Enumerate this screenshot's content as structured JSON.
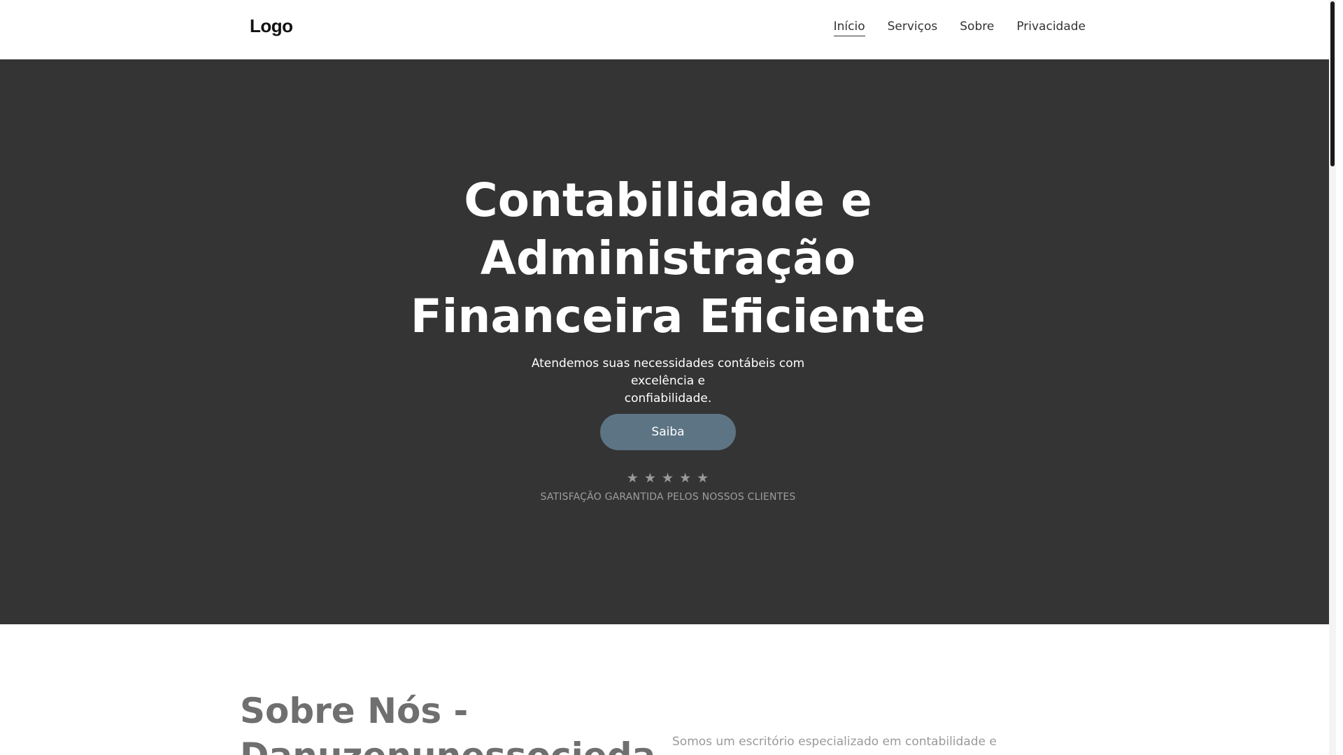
{
  "header": {
    "logo": "Logo",
    "nav": [
      {
        "label": "Início",
        "active": true
      },
      {
        "label": "Serviços",
        "active": false
      },
      {
        "label": "Sobre",
        "active": false
      },
      {
        "label": "Privacidade",
        "active": false
      }
    ]
  },
  "hero": {
    "title_lines": [
      "Contabilidade e",
      "Administração",
      "Financeira Eficiente"
    ],
    "subtitle_line1": "Atendemos suas necessidades contábeis com excelência e",
    "subtitle_line2": "confiabilidade.",
    "button_label": "Saiba",
    "rating": {
      "stars": 5,
      "max": 5,
      "glyph": "★"
    },
    "tagline": "SATISFAÇÃO GARANTIDA PELOS NOSSOS CLIENTES",
    "background_color": "#343434",
    "button_color": "#5d7484"
  },
  "about": {
    "title_line1": "Sobre Nós -",
    "title_line2": "Danuzenunessocieda",
    "text": "Somos um escritório especializado em contabilidade e"
  }
}
